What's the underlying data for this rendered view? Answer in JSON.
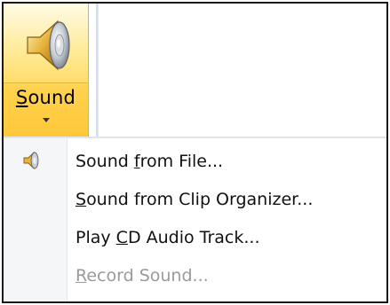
{
  "ribbon": {
    "sound_button": {
      "label_mnemonic": "S",
      "label_rest": "ound",
      "icon": "speaker-icon",
      "dropdown_icon": "dropdown-arrow-icon"
    }
  },
  "menu": {
    "items": [
      {
        "pre": "Sound ",
        "mnemonic": "f",
        "post": "rom File...",
        "icon": "speaker-icon",
        "enabled": true
      },
      {
        "pre": "",
        "mnemonic": "S",
        "post": "ound from Clip Organizer...",
        "enabled": true
      },
      {
        "pre": "Play ",
        "mnemonic": "C",
        "post": "D Audio Track...",
        "enabled": true
      },
      {
        "pre": "",
        "mnemonic": "R",
        "post": "ecord Sound...",
        "enabled": false
      }
    ]
  },
  "colors": {
    "button_highlight": "#ffd24d",
    "gutter": "#f5f6f7",
    "disabled_text": "#9a9a9a"
  }
}
